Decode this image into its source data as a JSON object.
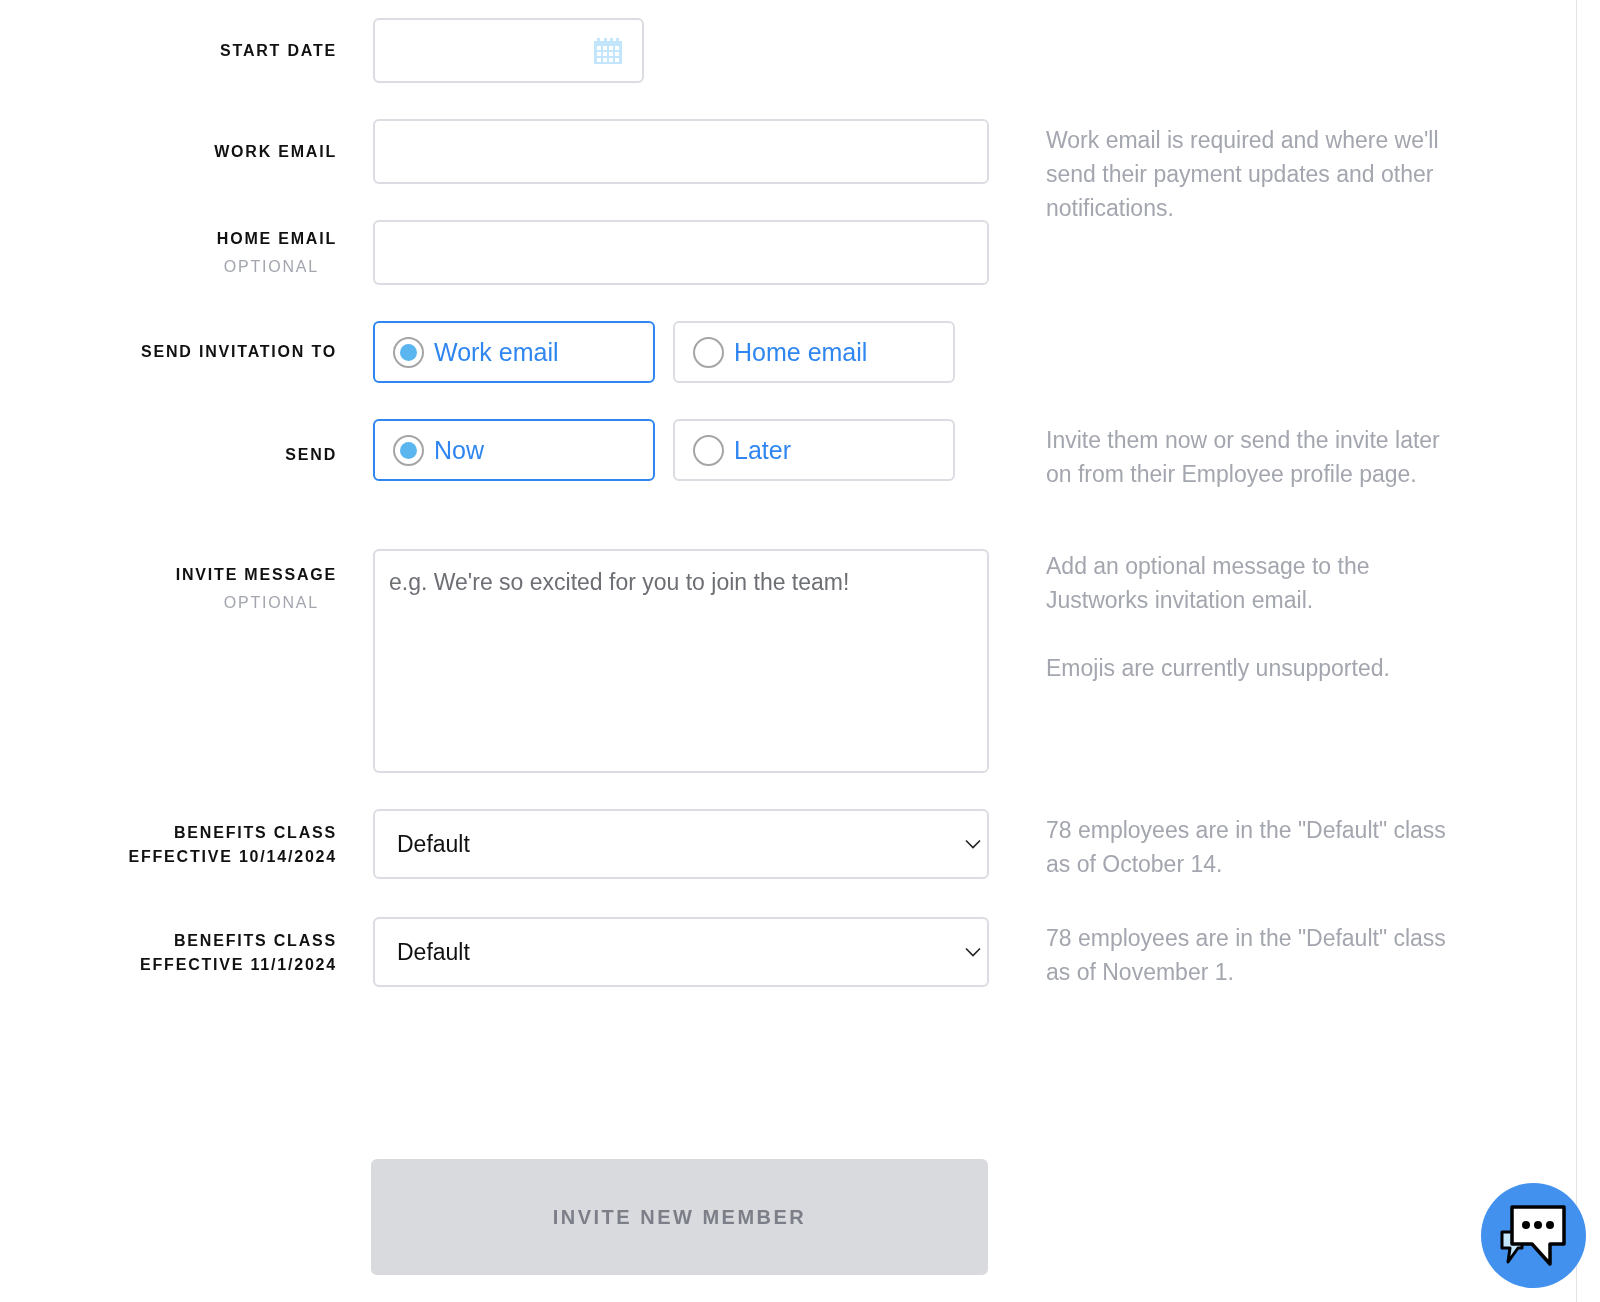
{
  "fields": [
    {
      "kind": "date",
      "label": [
        "START DATE"
      ]
    },
    {
      "kind": "text",
      "label": [
        "WORK EMAIL"
      ],
      "help": [
        "Work email is required and where we'll send their payment updates and other notifications."
      ]
    },
    {
      "kind": "text",
      "label": [
        "HOME EMAIL"
      ],
      "sublabel": "OPTIONAL"
    },
    {
      "kind": "radio",
      "label": [
        "SEND INVITATION TO"
      ],
      "options": [
        {
          "label": "Work email",
          "selected": true
        },
        {
          "label": "Home email",
          "selected": false
        }
      ]
    },
    {
      "kind": "radio",
      "label": [
        "SEND"
      ],
      "options": [
        {
          "label": "Now",
          "selected": true
        },
        {
          "label": "Later",
          "selected": false
        }
      ],
      "help": [
        "Invite them now or send the invite later on from their Employee profile page."
      ]
    },
    {
      "kind": "textarea",
      "label": [
        "INVITE MESSAGE"
      ],
      "sublabel": "OPTIONAL",
      "placeholder": "e.g. We're so excited for you to join the team!",
      "help": [
        "Add an optional message to the Justworks invitation email.",
        "Emojis are currently unsupported."
      ]
    },
    {
      "kind": "select",
      "label": [
        "BENEFITS CLASS",
        "EFFECTIVE 10/14/2024"
      ],
      "value": "Default",
      "help": [
        "78 employees are in the \"Default\" class as of October 14."
      ]
    },
    {
      "kind": "select",
      "label": [
        "BENEFITS CLASS",
        "EFFECTIVE 11/1/2024"
      ],
      "value": "Default",
      "help": [
        "78 employees are in the \"Default\" class as of November 1."
      ]
    }
  ],
  "submit": {
    "label": "INVITE NEW MEMBER",
    "disabled": true
  }
}
